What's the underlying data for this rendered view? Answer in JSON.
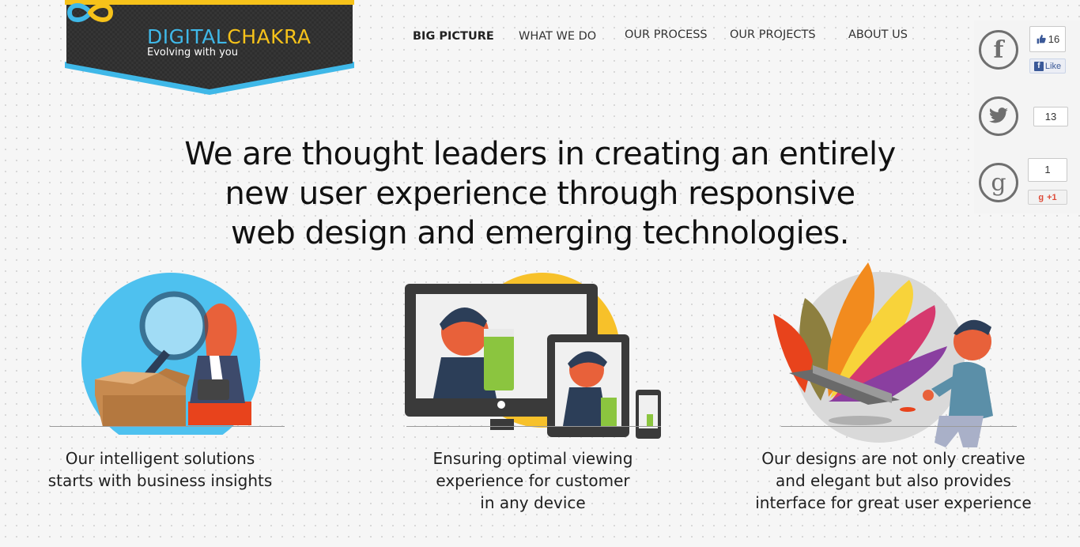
{
  "brand": {
    "name_part1": "DIGITAL",
    "name_part2": "CHAKRA",
    "tagline": "Evolving with you"
  },
  "nav": {
    "items": [
      {
        "label": "BIG PICTURE",
        "active": true
      },
      {
        "label": "WHAT WE DO",
        "active": false
      },
      {
        "label": "OUR PROCESS",
        "active": false
      },
      {
        "label": "OUR PROJECTS",
        "active": false
      },
      {
        "label": "ABOUT US",
        "active": false
      }
    ]
  },
  "social": {
    "facebook": {
      "icon": "facebook-icon",
      "count": "16",
      "like_label": "Like",
      "thumb_icon": "thumbs-up-icon"
    },
    "twitter": {
      "icon": "twitter-icon",
      "count": "13"
    },
    "google": {
      "icon": "google-icon",
      "count": "1",
      "plus_label": "+1"
    }
  },
  "headline": {
    "line1": "We are thought leaders in creating an entirely",
    "line2": "new user experience through responsive",
    "line3": "web design and emerging technologies."
  },
  "features": [
    {
      "illustration": "business-insights-illustration",
      "line1": "Our intelligent solutions",
      "line2": "starts with business insights"
    },
    {
      "illustration": "multi-device-illustration",
      "line1": "Ensuring optimal viewing",
      "line2": "experience for customer",
      "line3": "in any device"
    },
    {
      "illustration": "creative-design-illustration",
      "line1": "Our designs are not only creative",
      "line2": "and elegant but also provides",
      "line3": "interface for great user experience"
    }
  ],
  "colors": {
    "brand_blue": "#3fb8e8",
    "brand_yellow": "#f6c21a",
    "banner_dark": "#2f2f2f",
    "social_gray": "#6f6f6f"
  }
}
